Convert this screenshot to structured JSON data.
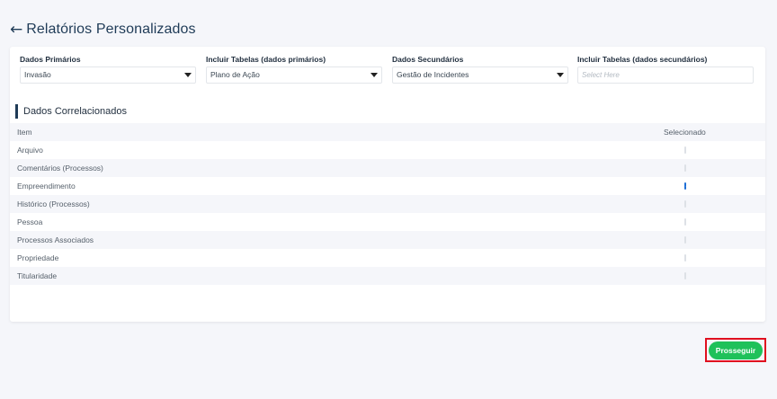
{
  "header": {
    "back_icon": "←",
    "title": "Relatórios Personalizados"
  },
  "filters": [
    {
      "label": "Dados Primários",
      "value": "Invasão",
      "placeholder": ""
    },
    {
      "label": "Incluir Tabelas (dados primários)",
      "value": "Plano de Ação",
      "placeholder": ""
    },
    {
      "label": "Dados Secundários",
      "value": "Gestão de Incidentes",
      "placeholder": ""
    },
    {
      "label": "Incluir Tabelas (dados secundários)",
      "value": "",
      "placeholder": "Select Here"
    }
  ],
  "section": {
    "title": "Dados Correlacionados"
  },
  "table": {
    "columns": {
      "item": "Item",
      "selected": "Selecionado"
    },
    "rows": [
      {
        "item": "Arquivo",
        "selected": false
      },
      {
        "item": "Comentários (Processos)",
        "selected": false
      },
      {
        "item": "Empreendimento",
        "selected": true
      },
      {
        "item": "Histórico (Processos)",
        "selected": false
      },
      {
        "item": "Pessoa",
        "selected": false
      },
      {
        "item": "Processos Associados",
        "selected": false
      },
      {
        "item": "Propriedade",
        "selected": false
      },
      {
        "item": "Titularidade",
        "selected": false
      }
    ]
  },
  "actions": {
    "proceed_label": "Prosseguir"
  },
  "colors": {
    "accent": "#1f3b57",
    "proceed": "#1fc15a",
    "highlight": "#e0101f",
    "checkbox_checked": "#1e6ed6"
  }
}
